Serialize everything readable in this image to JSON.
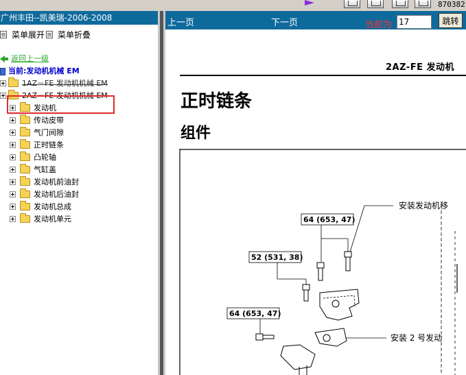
{
  "top_bar": {
    "code_fragment": "870382"
  },
  "sidebar": {
    "title": "广州丰田--凯美瑞-2006-2008",
    "expand_label": "菜单展开",
    "collapse_label": "菜单折叠",
    "back_label": "返回上一级",
    "current_label": "当前:发动机机械 EM",
    "items": [
      {
        "label": "1AZ－FE 发动机机械 EM"
      },
      {
        "label": "2AZ－FE 发动机机械 EM"
      }
    ],
    "subitems": [
      {
        "label": "发动机"
      },
      {
        "label": "传动皮带"
      },
      {
        "label": "气门间隙"
      },
      {
        "label": "正时链条"
      },
      {
        "label": "凸轮轴"
      },
      {
        "label": "气缸盖"
      },
      {
        "label": "发动机前油封"
      },
      {
        "label": "发动机后油封"
      },
      {
        "label": "发动机总成"
      },
      {
        "label": "发动机单元"
      }
    ]
  },
  "viewer": {
    "prev_label": "上一页",
    "next_label": "下一页",
    "current_page_label": "当前为",
    "page_value": "17",
    "jump_label": "跳转"
  },
  "document": {
    "header_title": "2AZ-FE 发动机",
    "title": "正时链条",
    "subtitle": "组件",
    "torque_labels": [
      "64 (653, 47)",
      "52 (531, 38)",
      "64 (653, 47)"
    ],
    "callouts": [
      "安装发动机移",
      "安装 2 号发动"
    ]
  },
  "colors": {
    "panel_blue": "#0f6a9c",
    "current_red": "#ff3030",
    "back_green": "#2aa52a",
    "highlight_red": "#e02a2a"
  }
}
